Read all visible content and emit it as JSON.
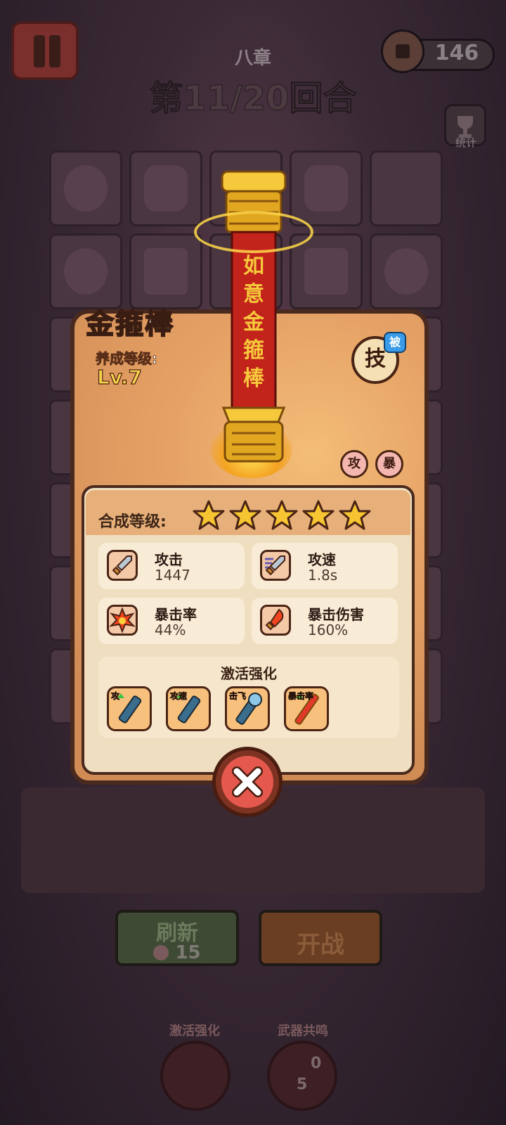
{
  "header": {
    "chapter": "八章",
    "round": "第11/20回合",
    "coins": "146",
    "stats_label": "统计"
  },
  "bottom": {
    "refresh_label": "刷新",
    "refresh_cost": "15",
    "battle_label": "开战",
    "activate_label": "激活强化",
    "resonance_label": "武器共鸣",
    "resonance_count_a": "0",
    "resonance_count_b": "5"
  },
  "weapon": {
    "name": "金箍棒",
    "staff_inscription": "如意金箍棒",
    "growth_label": "养成等级:",
    "growth_level": "Lv.7",
    "skill_badge": "技",
    "passive_tag": "被",
    "tag_attack": "攻",
    "tag_crit": "暴",
    "merge_label": "合成等级:",
    "merge_stars": 5,
    "stats": [
      {
        "name": "攻击",
        "value": "1447",
        "icon": "sword-icon"
      },
      {
        "name": "攻速",
        "value": "1.8s",
        "icon": "sword-speed-icon"
      },
      {
        "name": "暴击率",
        "value": "44%",
        "icon": "crit-burst-icon"
      },
      {
        "name": "暴击伤害",
        "value": "160%",
        "icon": "flame-sword-icon"
      }
    ],
    "enhance_title": "激活强化",
    "enhancements": [
      {
        "label": "攻",
        "icon": "staff-attack-up-icon"
      },
      {
        "label": "攻速",
        "icon": "staff-speed-up-icon"
      },
      {
        "label": "击飞",
        "icon": "staff-knockback-icon"
      },
      {
        "label": "暴击率",
        "icon": "golden-staff-crit-up-icon"
      }
    ]
  },
  "colors": {
    "panel_border": "#4a2a1e",
    "panel_bg": "#e6a266",
    "card_bg": "#efdfc0",
    "star": "#f7c531",
    "close_red": "#e5584e",
    "staff_red": "#c2231b",
    "staff_gold": "#f6c83b"
  }
}
